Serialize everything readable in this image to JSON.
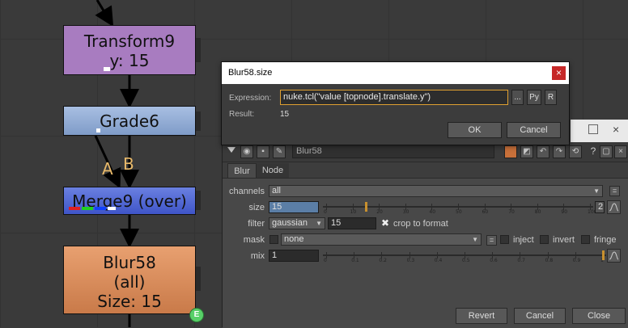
{
  "node_graph": {
    "nodes": {
      "transform": {
        "name": "Transform9",
        "label": "y: 15"
      },
      "grade": {
        "name": "Grade6"
      },
      "merge": {
        "name": "Merge9 (over)"
      },
      "blur": {
        "name": "Blur58",
        "channels": "(all)",
        "size_label": "Size: 15"
      }
    },
    "edge_labels": {
      "a": "A",
      "b": "B"
    },
    "badge": "E"
  },
  "expression_dialog": {
    "title": "Blur58.size",
    "expression_label": "Expression:",
    "expression_value": "nuke.tcl(\"value [topnode].translate.y\")",
    "browse_label": "...",
    "python_label": "Py",
    "r_label": "R",
    "result_label": "Result:",
    "result_value": "15",
    "ok_label": "OK",
    "cancel_label": "Cancel",
    "close_glyph": "×"
  },
  "properties_panel": {
    "node_name": "Blur58",
    "tabs": [
      {
        "label": "Blur"
      },
      {
        "label": "Node"
      }
    ],
    "knobs": {
      "channels": {
        "label": "channels",
        "value": "all"
      },
      "size": {
        "label": "size",
        "value": "15",
        "slider_value": 15,
        "slider_ticks": [
          "0",
          "10",
          "20",
          "30",
          "40",
          "50",
          "60",
          "70",
          "80",
          "90",
          "100"
        ],
        "views": "2"
      },
      "filter": {
        "label": "filter",
        "value": "gaussian",
        "quality": "15",
        "crop_label": "crop to format",
        "crop_checked": true
      },
      "mask": {
        "label": "mask",
        "value": "none",
        "inject_label": "inject",
        "invert_label": "invert",
        "fringe_label": "fringe"
      },
      "mix": {
        "label": "mix",
        "value": "1",
        "slider_value": 1,
        "slider_ticks": [
          "0",
          "0.1",
          "0.2",
          "0.3",
          "0.4",
          "0.5",
          "0.6",
          "0.7",
          "0.8",
          "0.9",
          "1"
        ]
      }
    },
    "buttons": {
      "revert": "Revert",
      "cancel": "Cancel",
      "close": "Close"
    },
    "toolbar_help": "?"
  },
  "colors": {
    "transform": "#a87cc0",
    "grade": "#8fa9d4",
    "merge": "#5066d8",
    "blur": "#d98c5c",
    "accent": "#e0a030"
  }
}
